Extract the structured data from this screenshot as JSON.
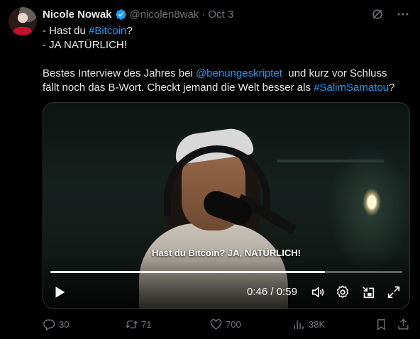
{
  "author": {
    "name": "Nicole Nowak",
    "handle": "@nicolen8wak",
    "separator": "·",
    "date": "Oct 3"
  },
  "tweet": {
    "line1_prefix": "- Hast du ",
    "line1_link": "#Bitcoin",
    "line1_suffix": "?",
    "line2": "- JA NATÜRLICH!",
    "line3_prefix": "Bestes Interview des Jahres bei ",
    "line3_link": "@benungeskriptet",
    "line3_suffix": "  und kurz vor Schluss",
    "line4_prefix": "fällt noch das B-Wort. Checkt jemand die Welt besser als ",
    "line4_link": "#SalimSamatou",
    "line4_suffix": "?"
  },
  "video": {
    "caption": "Hast du Bitcoin? JA, NATÜRLICH!",
    "current_time": "0:46",
    "time_separator": " / ",
    "duration": "0:59",
    "progress_fraction": 0.78
  },
  "actions": {
    "replies": "30",
    "reposts": "71",
    "likes": "700",
    "views": "38K"
  },
  "icons": {
    "verified": "verified-badge-icon",
    "grok": "grok-icon",
    "more": "more-icon",
    "play": "play-icon",
    "volume": "volume-icon",
    "settings": "settings-icon",
    "dock": "dock-icon",
    "fullscreen": "fullscreen-icon",
    "reply": "reply-icon",
    "repost": "repost-icon",
    "like": "like-icon",
    "views": "views-icon",
    "bookmark": "bookmark-icon",
    "share": "share-icon"
  },
  "colors": {
    "background": "#000000",
    "text": "#e7e9ea",
    "secondary": "#71767b",
    "link": "#1d9bf0",
    "verified": "#1d9bf0"
  }
}
